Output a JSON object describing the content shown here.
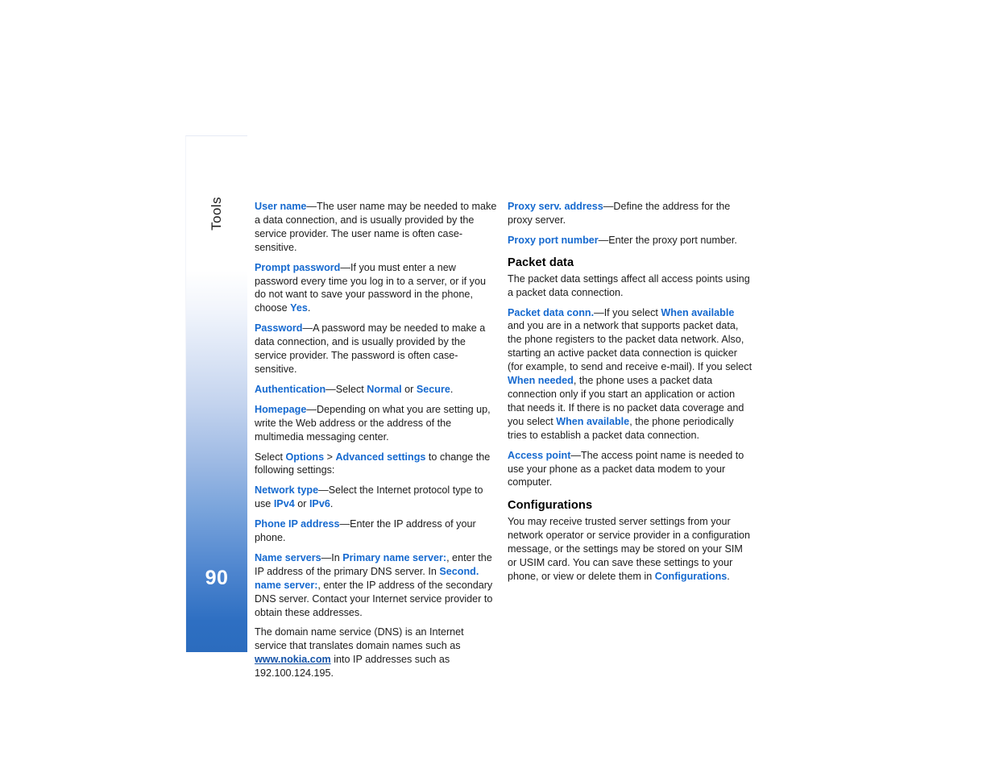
{
  "page": {
    "number": "90",
    "chapter": "Tools",
    "accent_blue": "#1569cf",
    "link_blue": "#1453a8",
    "tab_gradient_bottom": "#2b6cbe"
  },
  "left_column": {
    "paragraphs": [
      {
        "id": "user-name",
        "term": "User name",
        "body": "—The user name may be needed to make a data connection, and is usually provided by the service provider. The user name is often case-sensitive."
      },
      {
        "id": "prompt-password",
        "term": "Prompt password",
        "body_1": "—If you must enter a new password every time you log in to a server, or if you do not want to save your password in the phone, choose ",
        "inline_kw_1": "Yes",
        "body_2": "."
      },
      {
        "id": "password",
        "term": "Password",
        "body": "—A password may be needed to make a data connection, and is usually provided by the service provider. The password is often case-sensitive."
      },
      {
        "id": "authentication",
        "term": "Authentication",
        "body_1": "—Select ",
        "inline_kw_1": "Normal",
        "body_2": " or ",
        "inline_kw_2": "Secure",
        "body_3": "."
      },
      {
        "id": "homepage",
        "term": "Homepage",
        "body": "—Depending on what you are setting up, write the Web address or the address of the multimedia messaging center."
      },
      {
        "id": "select-options",
        "body_1": "Select ",
        "inline_kw_1": "Options",
        "body_2": " > ",
        "inline_kw_2": "Advanced settings",
        "body_3": " to change the following settings:"
      },
      {
        "id": "network-type",
        "term": "Network type",
        "body_1": "—Select the Internet protocol type to use ",
        "inline_kw_1": "IPv4",
        "body_2": " or ",
        "inline_kw_2": "IPv6",
        "body_3": "."
      },
      {
        "id": "phone-ip-address",
        "term": "Phone IP address",
        "body": "—Enter the IP address of your phone."
      },
      {
        "id": "name-servers",
        "term": "Name servers",
        "body_1": "—In ",
        "inline_kw_1": "Primary name server:",
        "body_2": ", enter the IP address of the primary DNS server. In ",
        "inline_kw_2": "Second. name server:",
        "body_3": ", enter the IP address of the secondary DNS server. Contact your Internet service provider to obtain these addresses."
      },
      {
        "id": "dns-explanation",
        "body_1": "The domain name service (DNS) is an Internet service that translates domain names such as ",
        "link_text": "www.nokia.com",
        "body_2": " into IP addresses such as 192.100.124.195."
      }
    ]
  },
  "right_column": {
    "paragraphs_top": [
      {
        "id": "proxy-serv-address",
        "term": "Proxy serv. address",
        "body": "—Define the address for the proxy server."
      },
      {
        "id": "proxy-port-number",
        "term": "Proxy port number",
        "body": "—Enter the proxy port number."
      }
    ],
    "packet_data": {
      "heading": "Packet data",
      "intro": "The packet data settings affect all access points using a packet data connection.",
      "packet_data_conn": {
        "term": "Packet data conn.",
        "body_1": "—If you select ",
        "inline_kw_1": "When available",
        "body_2": " and you are in a network that supports packet data, the phone registers to the packet data network. Also, starting an active packet data connection is quicker (for example, to send and receive e-mail). If you select ",
        "inline_kw_2": "When needed",
        "body_3": ", the phone uses a packet data connection only if you start an application or action that needs it. If there is no packet data coverage and you select ",
        "inline_kw_3": "When available",
        "body_4": ", the phone periodically tries to establish a packet data connection."
      },
      "access_point": {
        "term": "Access point",
        "body": "—The access point name is needed to use your phone as a packet data modem to your computer."
      }
    },
    "configurations": {
      "heading": "Configurations",
      "body_1": "You may receive trusted server settings from your network operator or service provider in a configuration message, or the settings may be stored on your SIM or USIM card. You can save these settings to your phone, or view or delete them in ",
      "inline_kw_1": "Configurations",
      "body_2": "."
    }
  }
}
